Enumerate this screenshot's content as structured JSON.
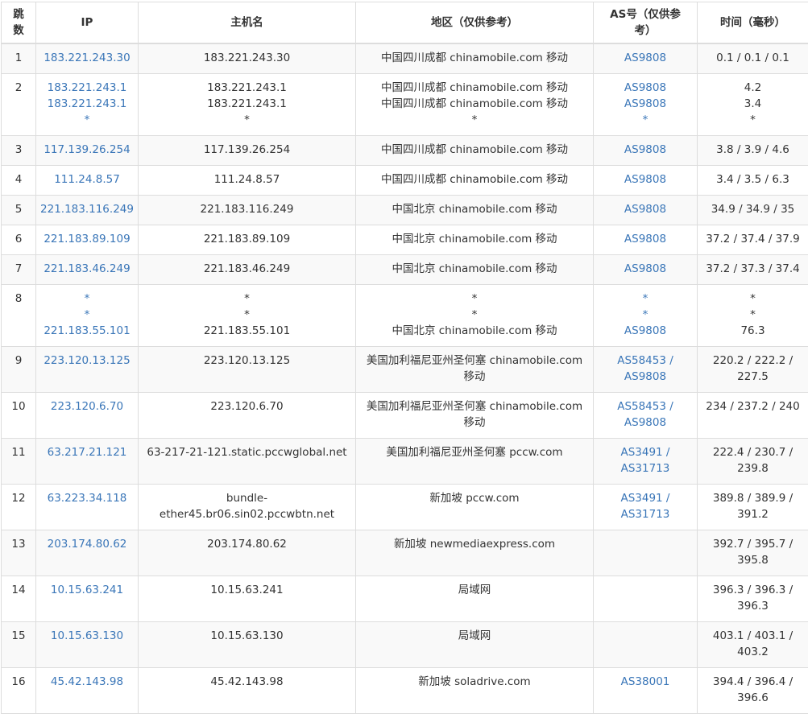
{
  "headers": {
    "hop": "跳数",
    "ip": "IP",
    "host": "主机名",
    "region": "地区（仅供参考）",
    "as": "AS号（仅供参考）",
    "time": "时间（毫秒）"
  },
  "rows": [
    {
      "hop": "1",
      "ip": [
        "183.221.243.30"
      ],
      "host": [
        "183.221.243.30"
      ],
      "region": [
        "中国四川成都 chinamobile.com 移动"
      ],
      "as": [
        "AS9808"
      ],
      "time": [
        "0.1 / 0.1 / 0.1"
      ]
    },
    {
      "hop": "2",
      "ip": [
        "183.221.243.1",
        "183.221.243.1",
        "*"
      ],
      "host": [
        "183.221.243.1",
        "183.221.243.1",
        "*"
      ],
      "region": [
        "中国四川成都 chinamobile.com 移动",
        "中国四川成都 chinamobile.com 移动",
        "*"
      ],
      "as": [
        "AS9808",
        "AS9808",
        "*"
      ],
      "time": [
        "4.2",
        "3.4",
        "*"
      ]
    },
    {
      "hop": "3",
      "ip": [
        "117.139.26.254"
      ],
      "host": [
        "117.139.26.254"
      ],
      "region": [
        "中国四川成都 chinamobile.com 移动"
      ],
      "as": [
        "AS9808"
      ],
      "time": [
        "3.8 / 3.9 / 4.6"
      ]
    },
    {
      "hop": "4",
      "ip": [
        "111.24.8.57"
      ],
      "host": [
        "111.24.8.57"
      ],
      "region": [
        "中国四川成都 chinamobile.com 移动"
      ],
      "as": [
        "AS9808"
      ],
      "time": [
        "3.4 / 3.5 / 6.3"
      ]
    },
    {
      "hop": "5",
      "ip": [
        "221.183.116.249"
      ],
      "host": [
        "221.183.116.249"
      ],
      "region": [
        "中国北京 chinamobile.com 移动"
      ],
      "as": [
        "AS9808"
      ],
      "time": [
        "34.9 / 34.9 / 35"
      ]
    },
    {
      "hop": "6",
      "ip": [
        "221.183.89.109"
      ],
      "host": [
        "221.183.89.109"
      ],
      "region": [
        "中国北京 chinamobile.com 移动"
      ],
      "as": [
        "AS9808"
      ],
      "time": [
        "37.2 / 37.4 / 37.9"
      ]
    },
    {
      "hop": "7",
      "ip": [
        "221.183.46.249"
      ],
      "host": [
        "221.183.46.249"
      ],
      "region": [
        "中国北京 chinamobile.com 移动"
      ],
      "as": [
        "AS9808"
      ],
      "time": [
        "37.2 / 37.3 / 37.4"
      ]
    },
    {
      "hop": "8",
      "ip": [
        "*",
        "*",
        "221.183.55.101"
      ],
      "host": [
        "*",
        "*",
        "221.183.55.101"
      ],
      "region": [
        "*",
        "*",
        "中国北京 chinamobile.com 移动"
      ],
      "as": [
        "*",
        "*",
        "AS9808"
      ],
      "time": [
        "*",
        "*",
        "76.3"
      ]
    },
    {
      "hop": "9",
      "ip": [
        "223.120.13.125"
      ],
      "host": [
        "223.120.13.125"
      ],
      "region": [
        "美国加利福尼亚州圣何塞 chinamobile.com 移动"
      ],
      "as": [
        "AS58453",
        "AS9808"
      ],
      "time": [
        "220.2 / 222.2 / 227.5"
      ]
    },
    {
      "hop": "10",
      "ip": [
        "223.120.6.70"
      ],
      "host": [
        "223.120.6.70"
      ],
      "region": [
        "美国加利福尼亚州圣何塞 chinamobile.com 移动"
      ],
      "as": [
        "AS58453",
        "AS9808"
      ],
      "time": [
        "234 / 237.2 / 240"
      ]
    },
    {
      "hop": "11",
      "ip": [
        "63.217.21.121"
      ],
      "host": [
        "63-217-21-121.static.pccwglobal.net"
      ],
      "region": [
        "美国加利福尼亚州圣何塞 pccw.com"
      ],
      "as": [
        "AS3491",
        "AS31713"
      ],
      "time": [
        "222.4 / 230.7 / 239.8"
      ]
    },
    {
      "hop": "12",
      "ip": [
        "63.223.34.118"
      ],
      "host": [
        "bundle-ether45.br06.sin02.pccwbtn.net"
      ],
      "region": [
        "新加坡 pccw.com"
      ],
      "as": [
        "AS3491",
        "AS31713"
      ],
      "time": [
        "389.8 / 389.9 / 391.2"
      ]
    },
    {
      "hop": "13",
      "ip": [
        "203.174.80.62"
      ],
      "host": [
        "203.174.80.62"
      ],
      "region": [
        "新加坡 newmediaexpress.com"
      ],
      "as": [],
      "time": [
        "392.7 / 395.7 / 395.8"
      ]
    },
    {
      "hop": "14",
      "ip": [
        "10.15.63.241"
      ],
      "host": [
        "10.15.63.241"
      ],
      "region": [
        "局域网"
      ],
      "as": [],
      "time": [
        "396.3 / 396.3 / 396.3"
      ]
    },
    {
      "hop": "15",
      "ip": [
        "10.15.63.130"
      ],
      "host": [
        "10.15.63.130"
      ],
      "region": [
        "局域网"
      ],
      "as": [],
      "time": [
        "403.1 / 403.1 / 403.2"
      ]
    },
    {
      "hop": "16",
      "ip": [
        "45.42.143.98"
      ],
      "host": [
        "45.42.143.98"
      ],
      "region": [
        "新加坡 soladrive.com"
      ],
      "as": [
        "AS38001"
      ],
      "time": [
        "394.4 / 396.4 / 396.6"
      ]
    }
  ]
}
